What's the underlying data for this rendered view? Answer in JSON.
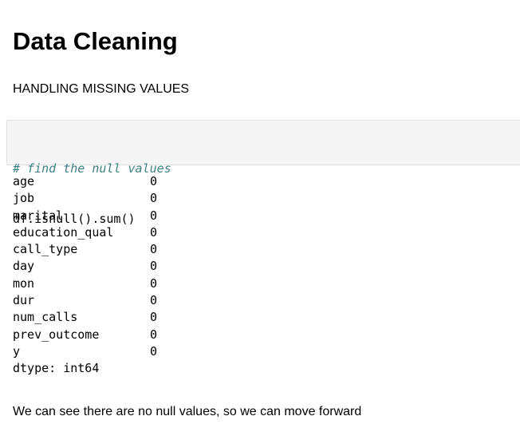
{
  "markdown": {
    "heading": "Data Cleaning",
    "subheading": "HANDLING MISSING VALUES",
    "conclusion": "We can see there are no null values, so we can move forward"
  },
  "code_cell": {
    "comment": "# find the null values",
    "code": "df.isnull().sum()"
  },
  "output": {
    "rows": [
      {
        "name": "age",
        "value": "0"
      },
      {
        "name": "job",
        "value": "0"
      },
      {
        "name": "marital",
        "value": "0"
      },
      {
        "name": "education_qual",
        "value": "0"
      },
      {
        "name": "call_type",
        "value": "0"
      },
      {
        "name": "day",
        "value": "0"
      },
      {
        "name": "mon",
        "value": "0"
      },
      {
        "name": "dur",
        "value": "0"
      },
      {
        "name": "num_calls",
        "value": "0"
      },
      {
        "name": "prev_outcome",
        "value": "0"
      },
      {
        "name": "y",
        "value": "0"
      }
    ],
    "dtype": "dtype: int64"
  },
  "colors": {
    "comment": "#408080",
    "cell_background": "#f5f5f5",
    "cell_border": "#e0e0e0"
  }
}
